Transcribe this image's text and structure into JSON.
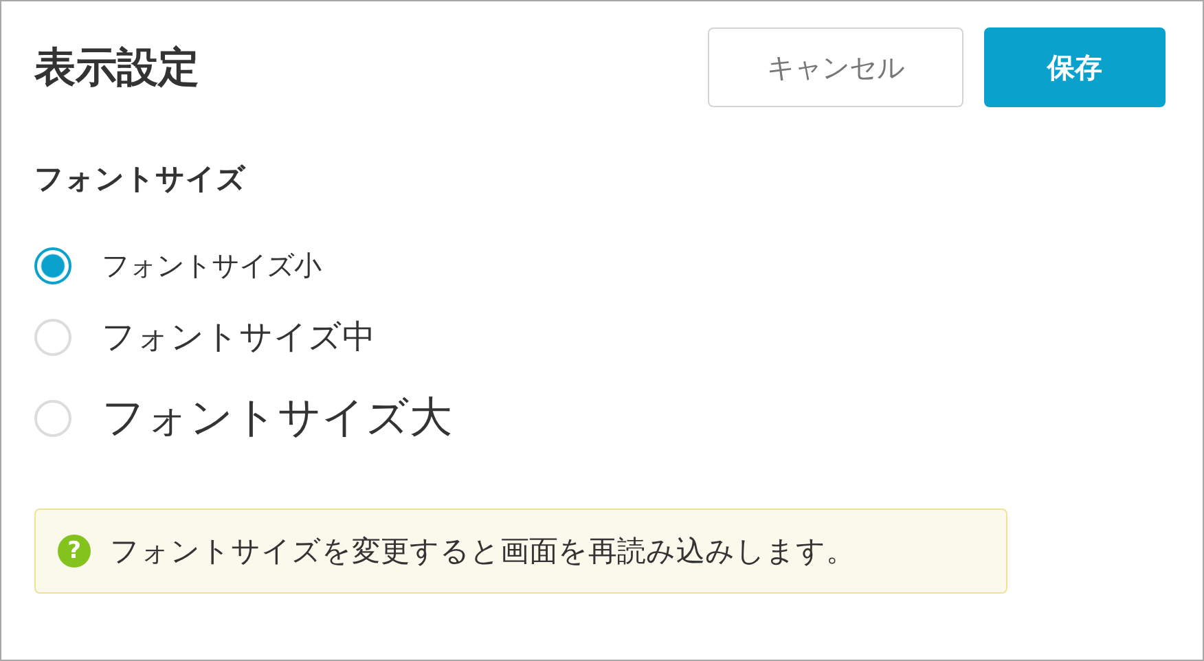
{
  "header": {
    "title": "表示設定",
    "buttons": [
      {
        "label": "キャンセル",
        "kind": "secondary"
      },
      {
        "label": "保存",
        "kind": "primary"
      }
    ]
  },
  "section": {
    "heading": "フォントサイズ",
    "options": [
      {
        "label": "フォントサイズ小",
        "kind": "small",
        "selected": true
      },
      {
        "label": "フォントサイズ中",
        "kind": "medium",
        "selected": false
      },
      {
        "label": "フォントサイズ大",
        "kind": "large",
        "selected": false
      }
    ]
  },
  "notice": {
    "icon": "?",
    "text": "フォントサイズを変更すると画面を再読み込みします。"
  }
}
